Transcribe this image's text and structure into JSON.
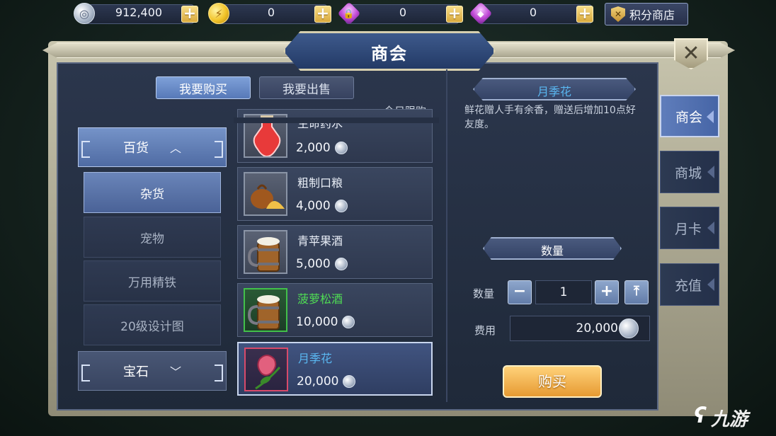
{
  "currencies": [
    {
      "icon": "silver-coin-icon",
      "value": "912,400"
    },
    {
      "icon": "gold-coin-icon",
      "value": "0"
    },
    {
      "icon": "locked-gem-icon",
      "value": "0"
    },
    {
      "icon": "gem-icon",
      "value": "0"
    }
  ],
  "plus_label": "+",
  "points_shop": {
    "label": "积分商店",
    "icon": "shield-icon"
  },
  "window": {
    "title": "商会",
    "close_label": "✕"
  },
  "trade_tabs": {
    "buy": "我要购买",
    "sell": "我要出售"
  },
  "limit_label": "今日限购",
  "categories": {
    "general": {
      "label": "百货",
      "arrow": "︿"
    },
    "sub": [
      "杂货",
      "宠物",
      "万用精铁",
      "20级设计图"
    ],
    "gem": {
      "label": "宝石",
      "arrow": "﹀"
    }
  },
  "items": [
    {
      "name": "生命药水",
      "price": "2,000",
      "icon": "potion-icon"
    },
    {
      "name": "粗制口粮",
      "price": "4,000",
      "icon": "ration-bag-icon"
    },
    {
      "name": "青苹果酒",
      "price": "5,000",
      "icon": "cider-mug-icon"
    },
    {
      "name": "菠萝松酒",
      "price": "10,000",
      "icon": "pineapple-wine-icon"
    },
    {
      "name": "月季花",
      "price": "20,000",
      "icon": "rose-icon"
    }
  ],
  "detail": {
    "name": "月季花",
    "description": "鲜花赠人手有余香，赠送后增加10点好友度。",
    "quantity_header": "数量",
    "quantity_label": "数量",
    "quantity_value": "1",
    "minus": "−",
    "plus": "+",
    "max": "⤒",
    "cost_label": "费用",
    "cost_value": "20,000",
    "buy_label": "购买"
  },
  "side_tabs": [
    "商会",
    "商城",
    "月卡",
    "充值"
  ],
  "watermark": "九游",
  "colors": {
    "accent": "#5a79b8",
    "buy_button": "#e69a32",
    "rare_item": "#4fdc54",
    "selected_item": "#5ab8f2"
  }
}
